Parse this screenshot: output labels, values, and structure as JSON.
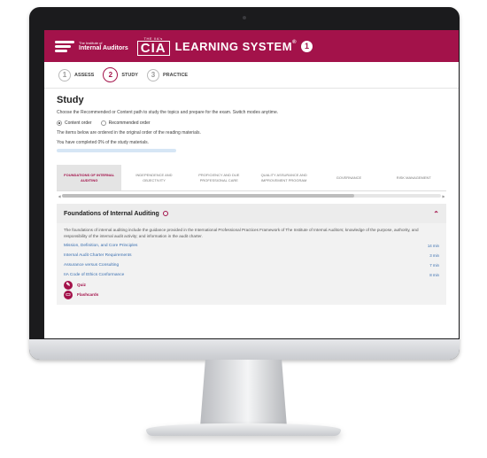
{
  "app": {
    "org_name_small": "The Institute of",
    "org_name": "Internal Auditors",
    "cia_top": "THE IIA's",
    "cia": "CIA",
    "system_title": "LEARNING SYSTEM",
    "reg_mark": "®",
    "version": "1"
  },
  "steps": [
    {
      "num": "1",
      "label": "ASSESS"
    },
    {
      "num": "2",
      "label": "STUDY"
    },
    {
      "num": "3",
      "label": "PRACTICE"
    }
  ],
  "study": {
    "title": "Study",
    "intro": "Choose the Recommended or Content path to study the topics and prepare for the exam. Switch modes anytime.",
    "radio_content": "Content order",
    "radio_recommended": "Recommended order",
    "order_note": "The items below are ordered in the original order of the reading materials.",
    "progress_text": "You have completed 0% of the study materials.",
    "progress_percent": 0
  },
  "tabs": [
    "Foundations of Internal Auditing",
    "Independence and Objectivity",
    "Proficiency and Due Professional Care",
    "Quality Assurance and Improvement Program",
    "Governance",
    "Risk Management"
  ],
  "section": {
    "title": "Foundations of Internal Auditing",
    "description": "The foundations of internal auditing include the guidance provided in the International Professional Practices Framework of The Institute of Internal Auditors; knowledge of the purpose, authority, and responsibility of the internal audit activity; and information in the audit charter.",
    "topics": [
      {
        "name": "Mission, Definition, and Core Principles",
        "duration": "14 min"
      },
      {
        "name": "Internal Audit Charter Requirements",
        "duration": "3 min"
      },
      {
        "name": "Assurance versus Consulting",
        "duration": "7 min"
      },
      {
        "name": "IIA Code of Ethics Conformance",
        "duration": "8 min"
      }
    ],
    "resources": [
      "Quiz",
      "Flashcards"
    ]
  },
  "colors": {
    "brand": "#a3124a",
    "link": "#3a6fb0"
  }
}
